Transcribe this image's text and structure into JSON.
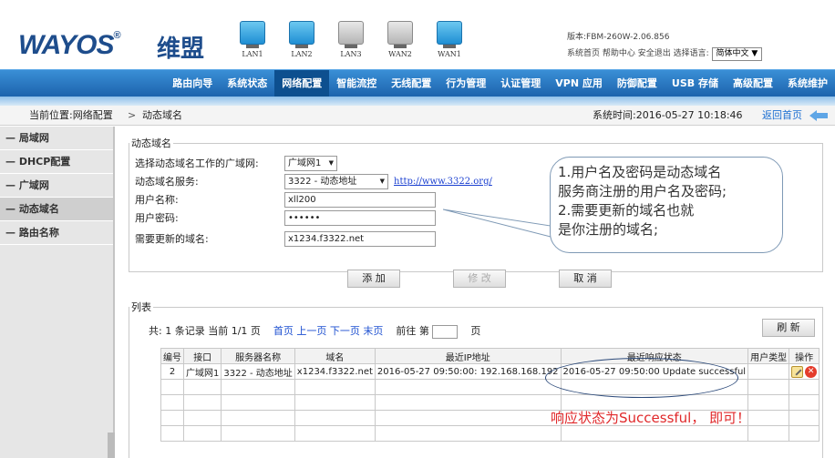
{
  "header": {
    "logo": "WAYOS",
    "logo_reg": "®",
    "logo_cn": "维盟",
    "ports": [
      {
        "label": "LAN1",
        "state": "on"
      },
      {
        "label": "LAN2",
        "state": "on"
      },
      {
        "label": "LAN3",
        "state": "off"
      },
      {
        "label": "WAN2",
        "state": "off"
      },
      {
        "label": "WAN1",
        "state": "on"
      }
    ],
    "version": "版本:FBM-260W-2.06.856",
    "links": "系统首页 帮助中心 安全退出 选择语言:",
    "language": "简体中文"
  },
  "nav": {
    "items": [
      "路由向导",
      "系统状态",
      "网络配置",
      "智能流控",
      "无线配置",
      "行为管理",
      "认证管理",
      "VPN 应用",
      "防御配置",
      "USB 存储",
      "高级配置",
      "系统维护"
    ],
    "active": "网络配置"
  },
  "breadcrumb": {
    "location": "当前位置:网络配置",
    "separator": ">",
    "page": "动态域名",
    "system_time": "系统时间:2016-05-27 10:18:46",
    "back_home": "返回首页"
  },
  "sidebar": {
    "items": [
      "— 局域网",
      "— DHCP配置",
      "— 广域网",
      "— 动态域名",
      "— 路由名称"
    ],
    "active": "— 动态域名"
  },
  "form": {
    "legend": "动态域名",
    "wan_label": "选择动态域名工作的广域网:",
    "wan_value": "广域网1",
    "service_label": "动态域名服务:",
    "service_value": "3322 - 动态地址",
    "service_link": "http://www.3322.org/",
    "username_label": "用户名称:",
    "username_value": "xll200",
    "password_label": "用户密码:",
    "password_value": "••••••",
    "domain_label": "需要更新的域名:",
    "domain_value": "x1234.f3322.net",
    "add_button": "添 加",
    "edit_button": "修 改",
    "cancel_button": "取 消"
  },
  "list": {
    "legend": "列表",
    "summary": "共: 1 条记录 当前 1/1 页",
    "first": "首页",
    "prev": "上一页",
    "next": "下一页",
    "last": "末页",
    "goto_prefix": "前往 第",
    "goto_suffix": "页",
    "refresh": "刷 新",
    "columns": [
      "编号",
      "接口",
      "服务器名称",
      "域名",
      "最近IP地址",
      "最近响应状态",
      "用户类型",
      "操作"
    ],
    "rows": [
      [
        "2",
        "广域网1",
        "3322 - 动态地址",
        "x1234.f3322.net",
        "2016-05-27 09:50:00: 192.168.168.192",
        "2016-05-27 09:50:00 Update successful",
        "",
        ""
      ]
    ]
  },
  "annotations": {
    "callout": [
      "1.用户名及密码是动态域名",
      "服务商注册的用户名及密码;",
      "2.需要更新的域名也就",
      "是你注册的域名;"
    ],
    "note": "响应状态为Successful， 即可！"
  }
}
